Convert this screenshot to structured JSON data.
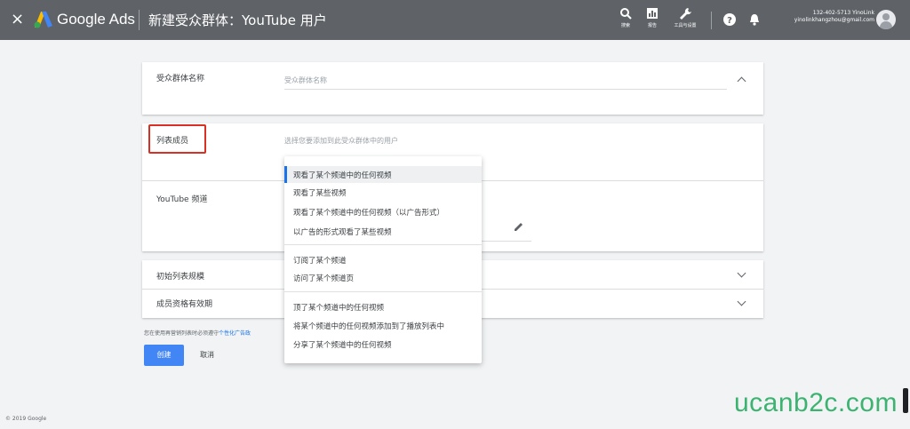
{
  "topbar": {
    "close_glyph": "×",
    "brand": "Google Ads",
    "title": "新建受众群体：YouTube 用户",
    "tools": [
      {
        "icon": "search-icon",
        "label": "搜索"
      },
      {
        "icon": "reports-icon",
        "label": "报告"
      },
      {
        "icon": "wrench-icon",
        "label": "工具与设置"
      }
    ],
    "account_id": "132-402-5713 YinoLink",
    "account_email": "yinolinkhangzhou@gmail.com",
    "colors": {
      "bar": "#5f6368"
    }
  },
  "audience_name": {
    "label": "受众群体名称",
    "placeholder": "受众群体名称"
  },
  "list_members": {
    "label": "列表成员",
    "placeholder": "选择您要添加到此受众群体中的用户"
  },
  "youtube_channel": {
    "label": "YouTube 频道"
  },
  "dropdown": {
    "groups": [
      [
        "观看了某个频道中的任何视频",
        "观看了某些视频",
        "观看了某个频道中的任何视频（以广告形式）",
        "以广告的形式观看了某些视频"
      ],
      [
        "订阅了某个频道",
        "访问了某个频道页"
      ],
      [
        "顶了某个频道中的任何视频",
        "将某个频道中的任何视频添加到了播放列表中",
        "分享了某个频道中的任何视频"
      ]
    ]
  },
  "initial_size": {
    "label": "初始列表规模"
  },
  "duration": {
    "label": "成员资格有效期"
  },
  "footer": {
    "note": "您在使用再营销列表时必须遵守",
    "note_link": "个性化广告政",
    "create": "创建",
    "cancel": "取消",
    "copyright": "© 2019 Google"
  },
  "watermark": "ucanb2c.com",
  "accent": "#1a73e8",
  "highlight": "#d93025"
}
